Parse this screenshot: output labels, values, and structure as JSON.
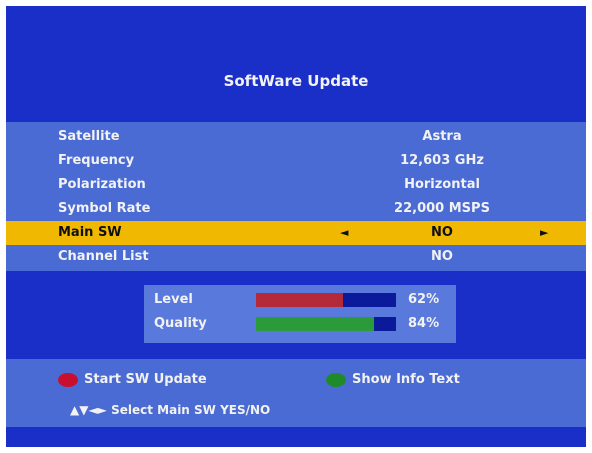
{
  "title": "SoftWare Update",
  "rows": [
    {
      "label": "Satellite",
      "value": "Astra"
    },
    {
      "label": "Frequency",
      "value": "12,603 GHz"
    },
    {
      "label": "Polarization",
      "value": "Horizontal"
    },
    {
      "label": "Symbol Rate",
      "value": "22,000 MSPS"
    },
    {
      "label": "Main SW",
      "value": "NO"
    },
    {
      "label": "Channel List",
      "value": "NO"
    }
  ],
  "arrows": {
    "left": "◄",
    "right": "►"
  },
  "signal": {
    "level": {
      "label": "Level",
      "percent_text": "62%",
      "value": 0.62,
      "color": "#b52a3a"
    },
    "quality": {
      "label": "Quality",
      "percent_text": "84%",
      "value": 0.84,
      "color": "#2a9a3a"
    }
  },
  "footer": {
    "red_label": "Start SW Update",
    "red_color": "#c8102e",
    "green_label": "Show Info Text",
    "green_color": "#1f8a2a",
    "nav_hint": "▲▼◄► Select Main SW YES/NO"
  },
  "colors": {
    "background": "#1a2fc8",
    "panel": "#4a6bd4",
    "highlight": "#f0b800"
  }
}
